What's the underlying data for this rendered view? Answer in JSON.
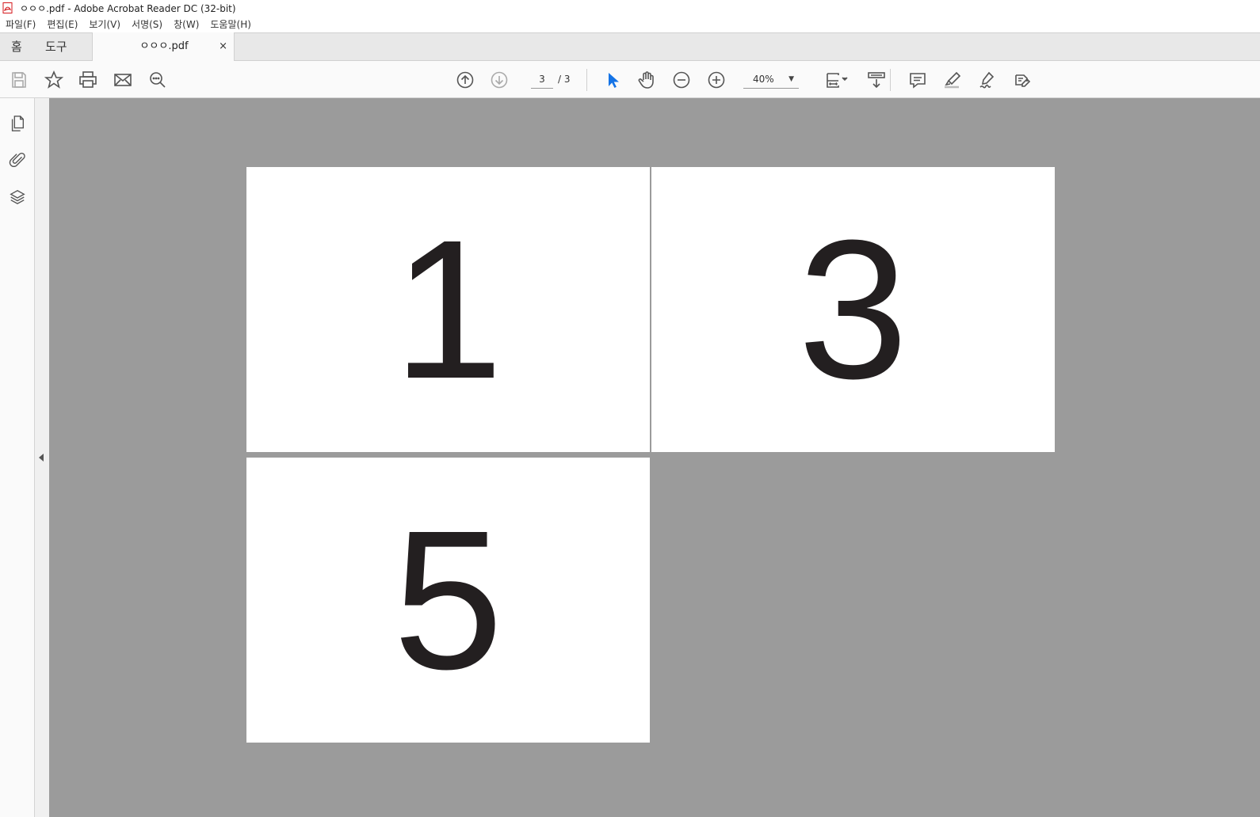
{
  "window": {
    "title": "ㅇㅇㅇ.pdf - Adobe Acrobat Reader DC (32-bit)"
  },
  "menu": [
    "파일(F)",
    "편집(E)",
    "보기(V)",
    "서명(S)",
    "창(W)",
    "도움말(H)"
  ],
  "tabs": {
    "home": "홈",
    "tools": "도구",
    "document": "ㅇㅇㅇ.pdf",
    "close": "×"
  },
  "toolbar": {
    "page_current": "3",
    "page_total": "/ 3",
    "zoom": "40%"
  },
  "pages": [
    {
      "number": "1"
    },
    {
      "number": "3"
    },
    {
      "number": "5"
    }
  ],
  "colors": {
    "canvas": "#9b9b9b",
    "select_tool": "#1473e6",
    "page_text": "#231f20"
  },
  "icons": [
    "pdf-app-icon",
    "save-icon",
    "star-icon",
    "print-icon",
    "mail-icon",
    "search-icon",
    "page-up-icon",
    "page-down-icon",
    "select-arrow-icon",
    "hand-icon",
    "zoom-out-icon",
    "zoom-in-icon",
    "fit-page-icon",
    "scroll-mode-icon",
    "comment-icon",
    "highlight-icon",
    "sign-icon",
    "edit-fill-icon",
    "pages-thumbnails-icon",
    "attachments-icon",
    "layers-icon"
  ]
}
